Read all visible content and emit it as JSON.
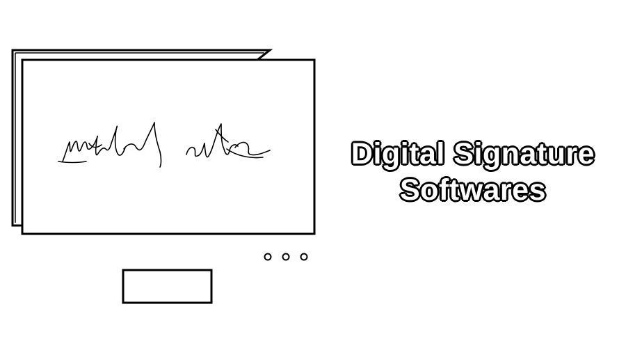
{
  "headline": {
    "line1": "Digital Signature",
    "line2": "Softwares"
  },
  "illustration": {
    "icon": "monitor-with-signature-icon",
    "signature_icon": "handwritten-signature-icon",
    "stroke_color": "#000000",
    "fill_color": "#ffffff"
  }
}
